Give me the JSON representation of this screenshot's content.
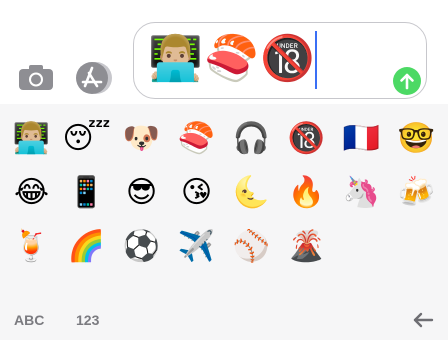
{
  "compose": {
    "camera_icon": "camera-icon",
    "appstore_icon": "app-store-icon",
    "typed_emojis": [
      "👨🏼‍💻",
      "🍣",
      "🔞"
    ],
    "send_icon": "arrow-up-icon",
    "colors": {
      "send": "#4cd964",
      "caret": "#3a6ff5",
      "icon_gray": "#8e8e93"
    }
  },
  "keyboard": {
    "emojis": [
      "👨🏼‍💻",
      "😴",
      "🐶",
      "🍣",
      "🎧",
      "🔞",
      "🇫🇷",
      "🤓",
      "😂",
      "📱",
      "😎",
      "😘",
      "🌜",
      "🔥",
      "🦄",
      "🍻",
      "🍹",
      "🌈",
      "⚽",
      "✈️",
      "⚾",
      "🌋"
    ],
    "abc_label": "ABC",
    "num_label": "123",
    "backspace_icon": "backspace-arrow-icon"
  }
}
